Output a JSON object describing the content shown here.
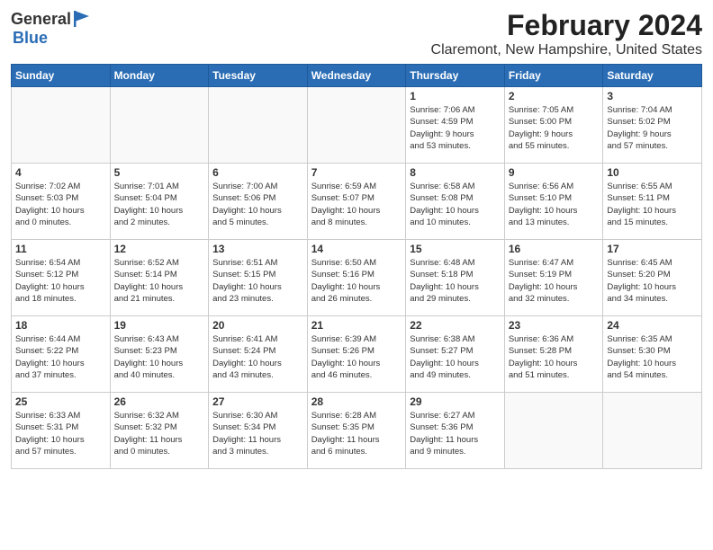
{
  "logo": {
    "general": "General",
    "blue": "Blue"
  },
  "header": {
    "month_year": "February 2024",
    "location": "Claremont, New Hampshire, United States"
  },
  "days_of_week": [
    "Sunday",
    "Monday",
    "Tuesday",
    "Wednesday",
    "Thursday",
    "Friday",
    "Saturday"
  ],
  "weeks": [
    [
      {
        "day": "",
        "info": ""
      },
      {
        "day": "",
        "info": ""
      },
      {
        "day": "",
        "info": ""
      },
      {
        "day": "",
        "info": ""
      },
      {
        "day": "1",
        "info": "Sunrise: 7:06 AM\nSunset: 4:59 PM\nDaylight: 9 hours\nand 53 minutes."
      },
      {
        "day": "2",
        "info": "Sunrise: 7:05 AM\nSunset: 5:00 PM\nDaylight: 9 hours\nand 55 minutes."
      },
      {
        "day": "3",
        "info": "Sunrise: 7:04 AM\nSunset: 5:02 PM\nDaylight: 9 hours\nand 57 minutes."
      }
    ],
    [
      {
        "day": "4",
        "info": "Sunrise: 7:02 AM\nSunset: 5:03 PM\nDaylight: 10 hours\nand 0 minutes."
      },
      {
        "day": "5",
        "info": "Sunrise: 7:01 AM\nSunset: 5:04 PM\nDaylight: 10 hours\nand 2 minutes."
      },
      {
        "day": "6",
        "info": "Sunrise: 7:00 AM\nSunset: 5:06 PM\nDaylight: 10 hours\nand 5 minutes."
      },
      {
        "day": "7",
        "info": "Sunrise: 6:59 AM\nSunset: 5:07 PM\nDaylight: 10 hours\nand 8 minutes."
      },
      {
        "day": "8",
        "info": "Sunrise: 6:58 AM\nSunset: 5:08 PM\nDaylight: 10 hours\nand 10 minutes."
      },
      {
        "day": "9",
        "info": "Sunrise: 6:56 AM\nSunset: 5:10 PM\nDaylight: 10 hours\nand 13 minutes."
      },
      {
        "day": "10",
        "info": "Sunrise: 6:55 AM\nSunset: 5:11 PM\nDaylight: 10 hours\nand 15 minutes."
      }
    ],
    [
      {
        "day": "11",
        "info": "Sunrise: 6:54 AM\nSunset: 5:12 PM\nDaylight: 10 hours\nand 18 minutes."
      },
      {
        "day": "12",
        "info": "Sunrise: 6:52 AM\nSunset: 5:14 PM\nDaylight: 10 hours\nand 21 minutes."
      },
      {
        "day": "13",
        "info": "Sunrise: 6:51 AM\nSunset: 5:15 PM\nDaylight: 10 hours\nand 23 minutes."
      },
      {
        "day": "14",
        "info": "Sunrise: 6:50 AM\nSunset: 5:16 PM\nDaylight: 10 hours\nand 26 minutes."
      },
      {
        "day": "15",
        "info": "Sunrise: 6:48 AM\nSunset: 5:18 PM\nDaylight: 10 hours\nand 29 minutes."
      },
      {
        "day": "16",
        "info": "Sunrise: 6:47 AM\nSunset: 5:19 PM\nDaylight: 10 hours\nand 32 minutes."
      },
      {
        "day": "17",
        "info": "Sunrise: 6:45 AM\nSunset: 5:20 PM\nDaylight: 10 hours\nand 34 minutes."
      }
    ],
    [
      {
        "day": "18",
        "info": "Sunrise: 6:44 AM\nSunset: 5:22 PM\nDaylight: 10 hours\nand 37 minutes."
      },
      {
        "day": "19",
        "info": "Sunrise: 6:43 AM\nSunset: 5:23 PM\nDaylight: 10 hours\nand 40 minutes."
      },
      {
        "day": "20",
        "info": "Sunrise: 6:41 AM\nSunset: 5:24 PM\nDaylight: 10 hours\nand 43 minutes."
      },
      {
        "day": "21",
        "info": "Sunrise: 6:39 AM\nSunset: 5:26 PM\nDaylight: 10 hours\nand 46 minutes."
      },
      {
        "day": "22",
        "info": "Sunrise: 6:38 AM\nSunset: 5:27 PM\nDaylight: 10 hours\nand 49 minutes."
      },
      {
        "day": "23",
        "info": "Sunrise: 6:36 AM\nSunset: 5:28 PM\nDaylight: 10 hours\nand 51 minutes."
      },
      {
        "day": "24",
        "info": "Sunrise: 6:35 AM\nSunset: 5:30 PM\nDaylight: 10 hours\nand 54 minutes."
      }
    ],
    [
      {
        "day": "25",
        "info": "Sunrise: 6:33 AM\nSunset: 5:31 PM\nDaylight: 10 hours\nand 57 minutes."
      },
      {
        "day": "26",
        "info": "Sunrise: 6:32 AM\nSunset: 5:32 PM\nDaylight: 11 hours\nand 0 minutes."
      },
      {
        "day": "27",
        "info": "Sunrise: 6:30 AM\nSunset: 5:34 PM\nDaylight: 11 hours\nand 3 minutes."
      },
      {
        "day": "28",
        "info": "Sunrise: 6:28 AM\nSunset: 5:35 PM\nDaylight: 11 hours\nand 6 minutes."
      },
      {
        "day": "29",
        "info": "Sunrise: 6:27 AM\nSunset: 5:36 PM\nDaylight: 11 hours\nand 9 minutes."
      },
      {
        "day": "",
        "info": ""
      },
      {
        "day": "",
        "info": ""
      }
    ]
  ]
}
